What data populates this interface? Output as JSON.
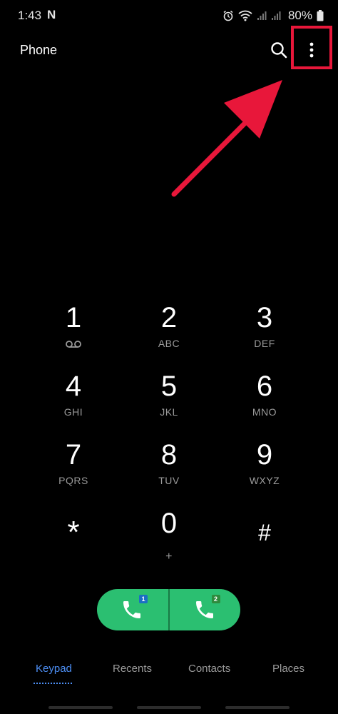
{
  "status_bar": {
    "time": "1:43",
    "app_icon_letter": "N",
    "battery": "80%"
  },
  "app_bar": {
    "title": "Phone",
    "search_icon": "search-icon",
    "more_icon": "more-vertical-icon"
  },
  "annotation": {
    "highlight_color": "#e8173a"
  },
  "keypad": [
    {
      "digit": "1",
      "letters": ""
    },
    {
      "digit": "2",
      "letters": "ABC"
    },
    {
      "digit": "3",
      "letters": "DEF"
    },
    {
      "digit": "4",
      "letters": "GHI"
    },
    {
      "digit": "5",
      "letters": "JKL"
    },
    {
      "digit": "6",
      "letters": "MNO"
    },
    {
      "digit": "7",
      "letters": "PQRS"
    },
    {
      "digit": "8",
      "letters": "TUV"
    },
    {
      "digit": "9",
      "letters": "WXYZ"
    },
    {
      "digit": "*",
      "letters": ""
    },
    {
      "digit": "0",
      "letters": "+"
    },
    {
      "digit": "#",
      "letters": ""
    }
  ],
  "call_buttons": [
    {
      "sim": "1"
    },
    {
      "sim": "2"
    }
  ],
  "tabs": [
    {
      "label": "Keypad",
      "active": true
    },
    {
      "label": "Recents"
    },
    {
      "label": "Contacts"
    },
    {
      "label": "Places"
    }
  ],
  "colors": {
    "background": "#000000",
    "call_green": "#2bbf71",
    "accent_blue": "#4d8ff5",
    "annotation_red": "#e8173a"
  }
}
